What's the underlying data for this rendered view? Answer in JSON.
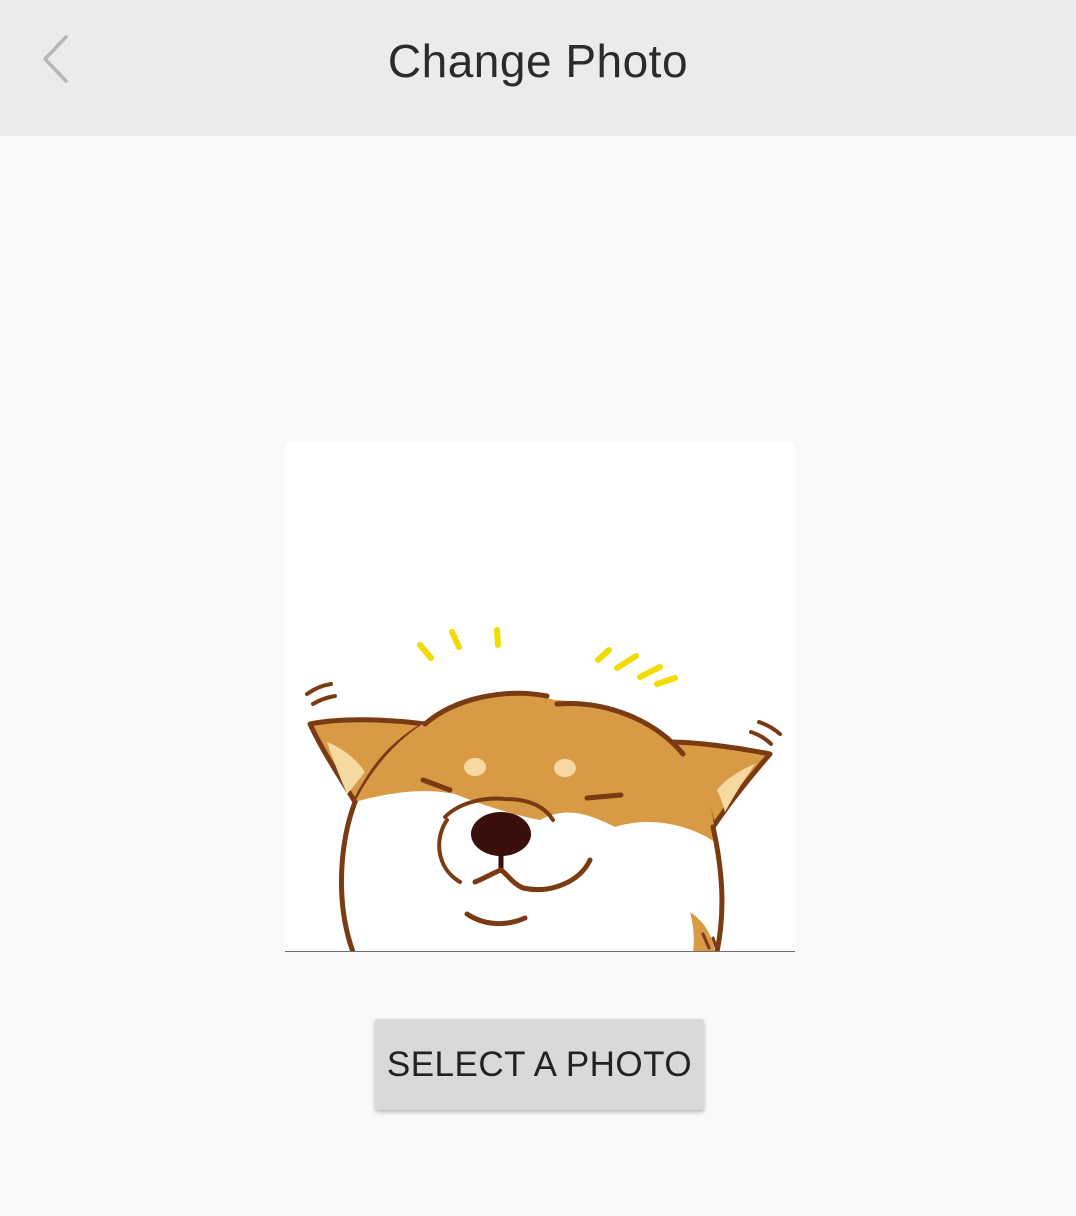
{
  "header": {
    "title": "Change Photo",
    "back_icon": "chevron-left-icon"
  },
  "photo": {
    "subject": "shiba-inu-illustration",
    "colors": {
      "fur": "#d89a45",
      "outline": "#7a3a12",
      "accent_lines": "#f2dc00",
      "background": "#ffffff"
    }
  },
  "actions": {
    "select_label": "SELECT A PHOTO"
  },
  "colors": {
    "topbar_bg": "#ebebed",
    "page_bg": "#f9f9f9",
    "button_bg": "#d8d9d9",
    "title_text": "#2b2b2b"
  }
}
